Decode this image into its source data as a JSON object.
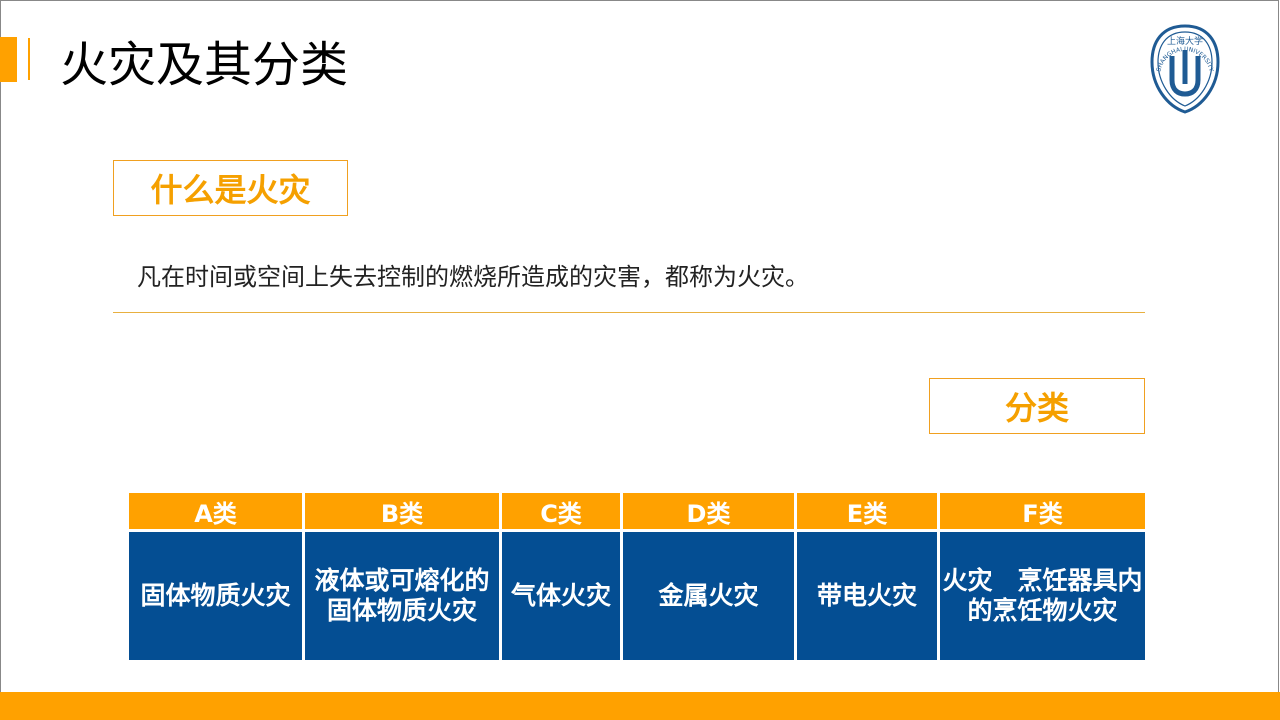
{
  "title": "火灾及其分类",
  "logo": {
    "top_text": "上海大学",
    "ring_text": "SHANGHAI UNIVERSITY",
    "color": "#1F5B94"
  },
  "what_is_fire": {
    "label": "什么是火灾",
    "definition": "凡在时间或空间上失去控制的燃烧所造成的灾害，都称为火灾。"
  },
  "classification": {
    "label": "分类",
    "headers": [
      "A类",
      "B类",
      "C类",
      "D类",
      "E类",
      "F类"
    ],
    "rows": [
      [
        "固体物质火灾",
        "液体或可熔化的固体物质火灾",
        "气体火灾",
        "金属火灾",
        "带电火灾",
        "火灾　烹饪器具内的烹饪物火灾"
      ]
    ]
  },
  "colors": {
    "accent_orange": "#FFA100",
    "table_blue": "#044E93",
    "heading_text": "#F5A000"
  }
}
